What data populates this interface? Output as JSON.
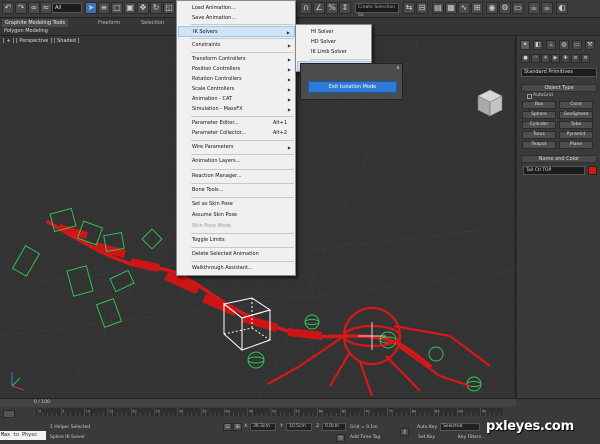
{
  "toolbar": {
    "selection_filter": "All",
    "named_selection_placeholder": "Create Selection Se"
  },
  "ribbon": {
    "tabs": [
      "Graphite Modeling Tools",
      "Freeform",
      "Selection"
    ],
    "sub_label": "Polygon Modeling"
  },
  "viewport": {
    "label": "[ + ] [ Perspective ] [ Shaded ]"
  },
  "animation_menu": {
    "items": [
      {
        "label": "Load Animation..."
      },
      {
        "label": "Save Animation..."
      },
      {
        "label": "IK Solvers",
        "submenu": true
      },
      {
        "label": "Constraints",
        "submenu": true
      },
      {
        "label": "Transform Controllers",
        "submenu": true
      },
      {
        "label": "Position Controllers",
        "submenu": true
      },
      {
        "label": "Rotation Controllers",
        "submenu": true
      },
      {
        "label": "Scale Controllers",
        "submenu": true
      },
      {
        "label": "Animation - CAT",
        "submenu": true
      },
      {
        "label": "Simulation - MassFX",
        "submenu": true
      },
      {
        "label": "Parameter Editor...",
        "shortcut": "Alt+1"
      },
      {
        "label": "Parameter Collector...",
        "shortcut": "Alt+2"
      },
      {
        "label": "Wire Parameters",
        "submenu": true
      },
      {
        "label": "Animation Layers..."
      },
      {
        "label": "Reaction Manager..."
      },
      {
        "label": "Bone Tools..."
      },
      {
        "label": "Set as Skin Pose"
      },
      {
        "label": "Assume Skin Pose"
      },
      {
        "label": "Skin Pose Mode",
        "disabled": true
      },
      {
        "label": "Toggle Limits"
      },
      {
        "label": "Delete Selected Animation"
      },
      {
        "label": "Walkthrough Assistant..."
      }
    ]
  },
  "ik_submenu": {
    "items": [
      "HI Solver",
      "HD Solver",
      "IK Limb Solver",
      "SplineIK Solver"
    ]
  },
  "isolate_panel": {
    "close": "x",
    "button": "Exit Isolation Mode"
  },
  "command_panel": {
    "dropdown": "Standard Primitives",
    "object_type_title": "Object Type",
    "autogrid": "AutoGrid",
    "buttons": [
      "Box",
      "Cone",
      "Sphere",
      "GeoSphere",
      "Cylinder",
      "Tube",
      "Torus",
      "Pyramid",
      "Teapot",
      "Plane"
    ],
    "name_color_title": "Name and Color",
    "name_value": "Tail Ctl TOP",
    "swatch_color": "#d81818"
  },
  "status": {
    "time_label": "0 / 100",
    "track_ticks": [
      "0",
      "5",
      "10",
      "15",
      "20",
      "25",
      "30",
      "35",
      "40",
      "45",
      "50",
      "55",
      "60",
      "65",
      "70",
      "75",
      "80",
      "85",
      "90",
      "95",
      "100"
    ],
    "maxscript": "Max to Physc",
    "selection_info": "1 Helper Selected",
    "prompt": "Spline IK Solver",
    "x_label": "X:",
    "x_value": "36.3cm",
    "y_label": "Y:",
    "y_value": "10.5cm",
    "z_label": "Z:",
    "z_value": "0.0cm",
    "grid": "Grid = 0.1m",
    "add_time_tag": "Add Time Tag",
    "auto_key": "Auto Key",
    "auto_key_value": "Selected",
    "set_key": "Set Key",
    "key_filters": "Key Filters..."
  },
  "watermark": "pxleyes.com"
}
